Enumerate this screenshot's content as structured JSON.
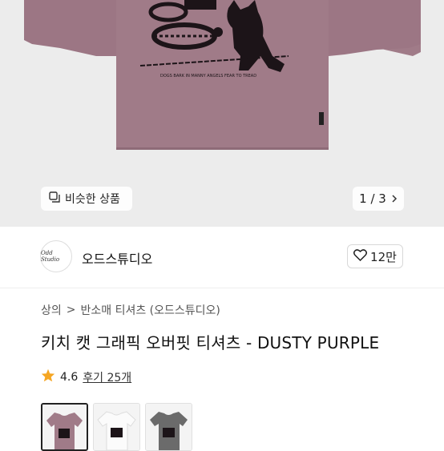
{
  "hero": {
    "shirt_color": "#a07b88",
    "print_text": "DOGS BARK IN MANNY ANGELS FEAR TO TREAD",
    "similar_label": "비슷한 상품",
    "similar_icon": "similar-items-icon",
    "pager_text": "1 / 3",
    "pager_icon": "chevron-right-icon"
  },
  "store": {
    "logo_text": "Odd Studio",
    "name": "오드스튜디오",
    "like_icon": "heart-icon",
    "like_count": "12만"
  },
  "breadcrumb": {
    "items": [
      "상의",
      "반소매 티셔츠 (오드스튜디오)"
    ],
    "separator": ">"
  },
  "product": {
    "title": "키치 캣 그래픽 오버핏 티셔츠 - DUSTY PURPLE"
  },
  "rating": {
    "star_icon": "star-icon",
    "star_color": "#f5a623",
    "score": "4.6",
    "reviews_label": "후기 25개"
  },
  "thumbnails": [
    {
      "color": "#a07b88",
      "selected": true
    },
    {
      "color": "#f3f3f3",
      "selected": false
    },
    {
      "color": "#6b6b6b",
      "selected": false
    }
  ]
}
